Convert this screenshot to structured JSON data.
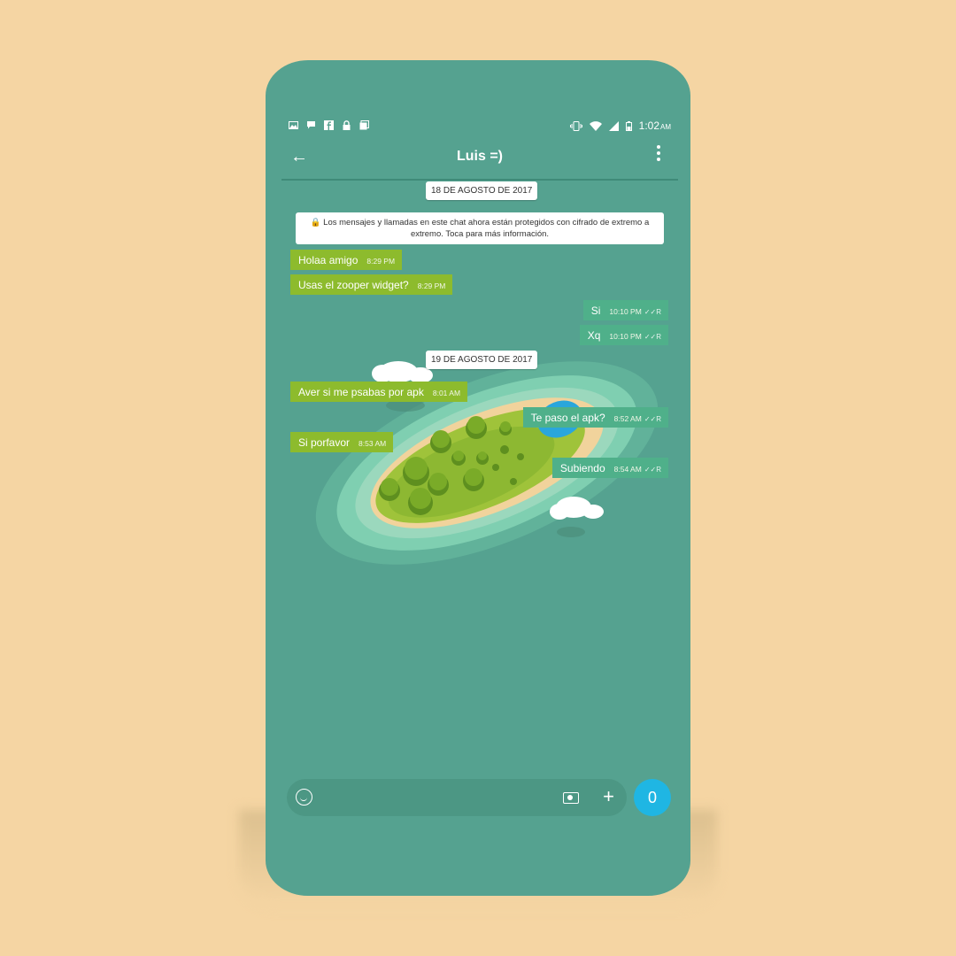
{
  "statusbar": {
    "left_icons": [
      "image-icon",
      "chat-icon",
      "facebook-icon",
      "lock-icon",
      "gallery-icon"
    ],
    "right_icons": [
      "vibrate-icon",
      "wifi-icon",
      "signal-icon",
      "battery-icon"
    ],
    "time": "1:02",
    "ampm": "AM"
  },
  "toolbar": {
    "title": "Luis =)",
    "back_icon": "←"
  },
  "chat": {
    "date1": "18 DE AGOSTO DE 2017",
    "notice": "🔒 Los mensajes y llamadas en este chat ahora están protegidos con cifrado de extremo a extremo. Toca para más información.",
    "date2": "19 DE AGOSTO DE 2017",
    "messages": [
      {
        "text": "Holaa amigo",
        "time": "8:29 PM",
        "dir": "in"
      },
      {
        "text": "Usas el zooper widget?",
        "time": "8:29 PM",
        "dir": "in"
      },
      {
        "text": "Si",
        "time": "10:10 PM",
        "dir": "out",
        "status": "✓✓R"
      },
      {
        "text": "Xq",
        "time": "10:10 PM",
        "dir": "out",
        "status": "✓✓R"
      },
      {
        "text": "Aver si me psabas por apk",
        "time": "8:01 AM",
        "dir": "in"
      },
      {
        "text": "Te paso el apk?",
        "time": "8:52 AM",
        "dir": "out",
        "status": "✓✓R"
      },
      {
        "text": "Si porfavor",
        "time": "8:53 AM",
        "dir": "in"
      },
      {
        "text": "Subiendo",
        "time": "8:54 AM",
        "dir": "out",
        "status": "✓✓R"
      }
    ]
  },
  "input": {
    "emoji_icon": "emoji-icon",
    "camera_icon": "camera-icon",
    "plus_label": "+",
    "send_label": "0"
  },
  "colors": {
    "background": "#f5d5a3",
    "phone": "#55a290",
    "incoming": "#8dbb2d",
    "outgoing": "#4fb08a",
    "send": "#1fb6e3"
  }
}
